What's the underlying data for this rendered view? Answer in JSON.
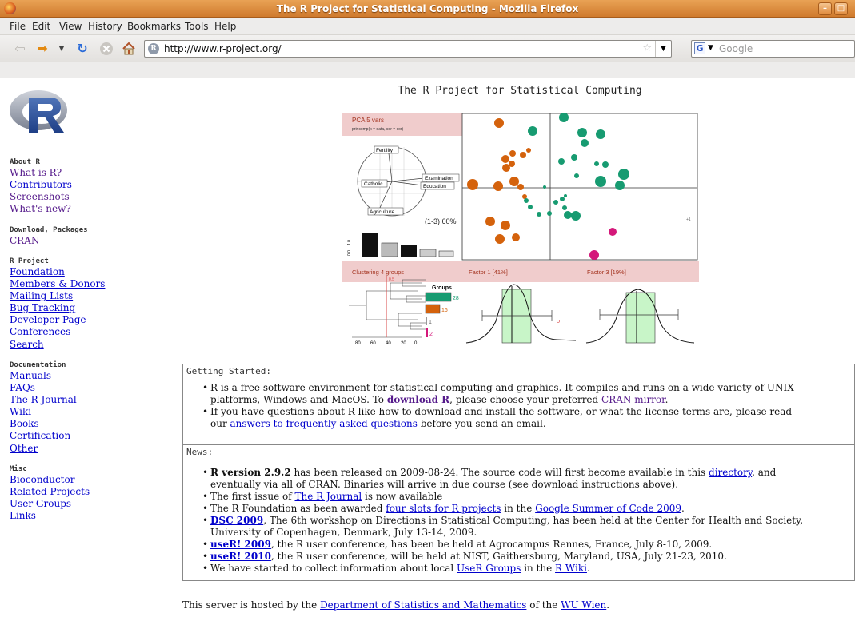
{
  "window": {
    "title": "The R Project for Statistical Computing - Mozilla Firefox"
  },
  "menu": [
    "File",
    "Edit",
    "View",
    "History",
    "Bookmarks",
    "Tools",
    "Help"
  ],
  "navigation": {
    "url": "http://www.r-project.org/",
    "search_placeholder": "Google",
    "search_engine_icon": "G"
  },
  "page": {
    "heading": "The R Project for Statistical Computing",
    "logo_letter": "R",
    "sidebar": {
      "sections": [
        {
          "title": "About R",
          "links": [
            "What is R?",
            "Contributors",
            "Screenshots",
            "What's new?"
          ]
        },
        {
          "title": "Download, Packages",
          "links": [
            "CRAN"
          ]
        },
        {
          "title": "R Project",
          "links": [
            "Foundation",
            "Members & Donors",
            "Mailing Lists",
            "Bug Tracking",
            "Developer Page",
            "Conferences",
            "Search"
          ]
        },
        {
          "title": "Documentation",
          "links": [
            "Manuals",
            "FAQs",
            "The R Journal",
            "Wiki",
            "Books",
            "Certification",
            "Other"
          ]
        },
        {
          "title": "Misc",
          "links": [
            "Bioconductor",
            "Related Projects",
            "User Groups",
            "Links"
          ]
        }
      ]
    },
    "graphic": {
      "pca_title": "PCA 5 vars",
      "pca_formula": "princomp(x = data, cor = cor)",
      "biplot_labels": [
        "Fertility",
        "Catholic",
        "Examination",
        "Education",
        "Agriculture"
      ],
      "variance_label": "(1-3) 60%",
      "scree_axis": [
        "0.0",
        "1.0"
      ],
      "clustering_title": "Clustering  4 groups",
      "factor1_title": "Factor 1 [41%]",
      "factor3_title": "Factor 3 [19%]",
      "groups_title": "Groups",
      "group_counts": [
        "28",
        "16",
        "1",
        "2"
      ],
      "dendro_axis": [
        "80",
        "60",
        "40",
        "20",
        "0"
      ],
      "scatter_side_label": "+1",
      "colors": {
        "orange": "#d4620c",
        "green": "#179b71",
        "magenta": "#d4187a",
        "pink_band": "#f0cccc",
        "light_green": "#c8f5c8"
      }
    },
    "getting_started": {
      "header": "Getting Started:",
      "items": [
        {
          "t1": "R is a free software environment for statistical computing and graphics. It compiles and runs on a wide variety of UNIX",
          "t2": "platforms, Windows and MacOS. To ",
          "link1": "download R",
          "t3": ", please choose your preferred ",
          "link2": "CRAN mirror",
          "t4": "."
        },
        {
          "t1": "If you have questions about R like how to download and install the software, or what the license terms are, please read",
          "t2": "our ",
          "link1": "answers to frequently asked questions",
          "t3": " before you send an email."
        }
      ]
    },
    "news": {
      "header": "News:",
      "items": [
        {
          "b": "R version 2.9.2",
          "t1": " has been released on 2009-08-24. The source code will first become available in this ",
          "link1": "directory",
          "t2": ", and",
          "t3": "eventually via all of CRAN. Binaries will arrive in due course (see download instructions above)."
        },
        {
          "t1": "The first issue of ",
          "link1": "The R Journal",
          "t2": " is now available"
        },
        {
          "t1": "The R Foundation as been awarded ",
          "link1": "four slots for R projects",
          "t2": " in the ",
          "link2": "Google Summer of Code 2009",
          "t3": "."
        },
        {
          "link1": "DSC 2009",
          "t1": ", The 6th workshop on Directions in Statistical Computing, has been held at the Center for Health and Society,",
          "t2": "University of Copenhagen, Denmark, July 13-14, 2009."
        },
        {
          "link1": "useR! 2009",
          "t1": ", the R user conference, has been be held at Agrocampus Rennes, France, July 8-10, 2009."
        },
        {
          "link1": "useR! 2010",
          "t1": ", the R user conference, will be held at NIST, Gaithersburg, Maryland, USA, July 21-23, 2010."
        },
        {
          "t1": "We have started to collect information about local ",
          "link1": "UseR Groups",
          "t2": " in the ",
          "link2": "R Wiki",
          "t3": "."
        }
      ]
    },
    "footer": {
      "t1": "This server is hosted by the ",
      "link1": "Department of Statistics and Mathematics",
      "t2": " of the ",
      "link2": "WU Wien",
      "t3": "."
    }
  }
}
